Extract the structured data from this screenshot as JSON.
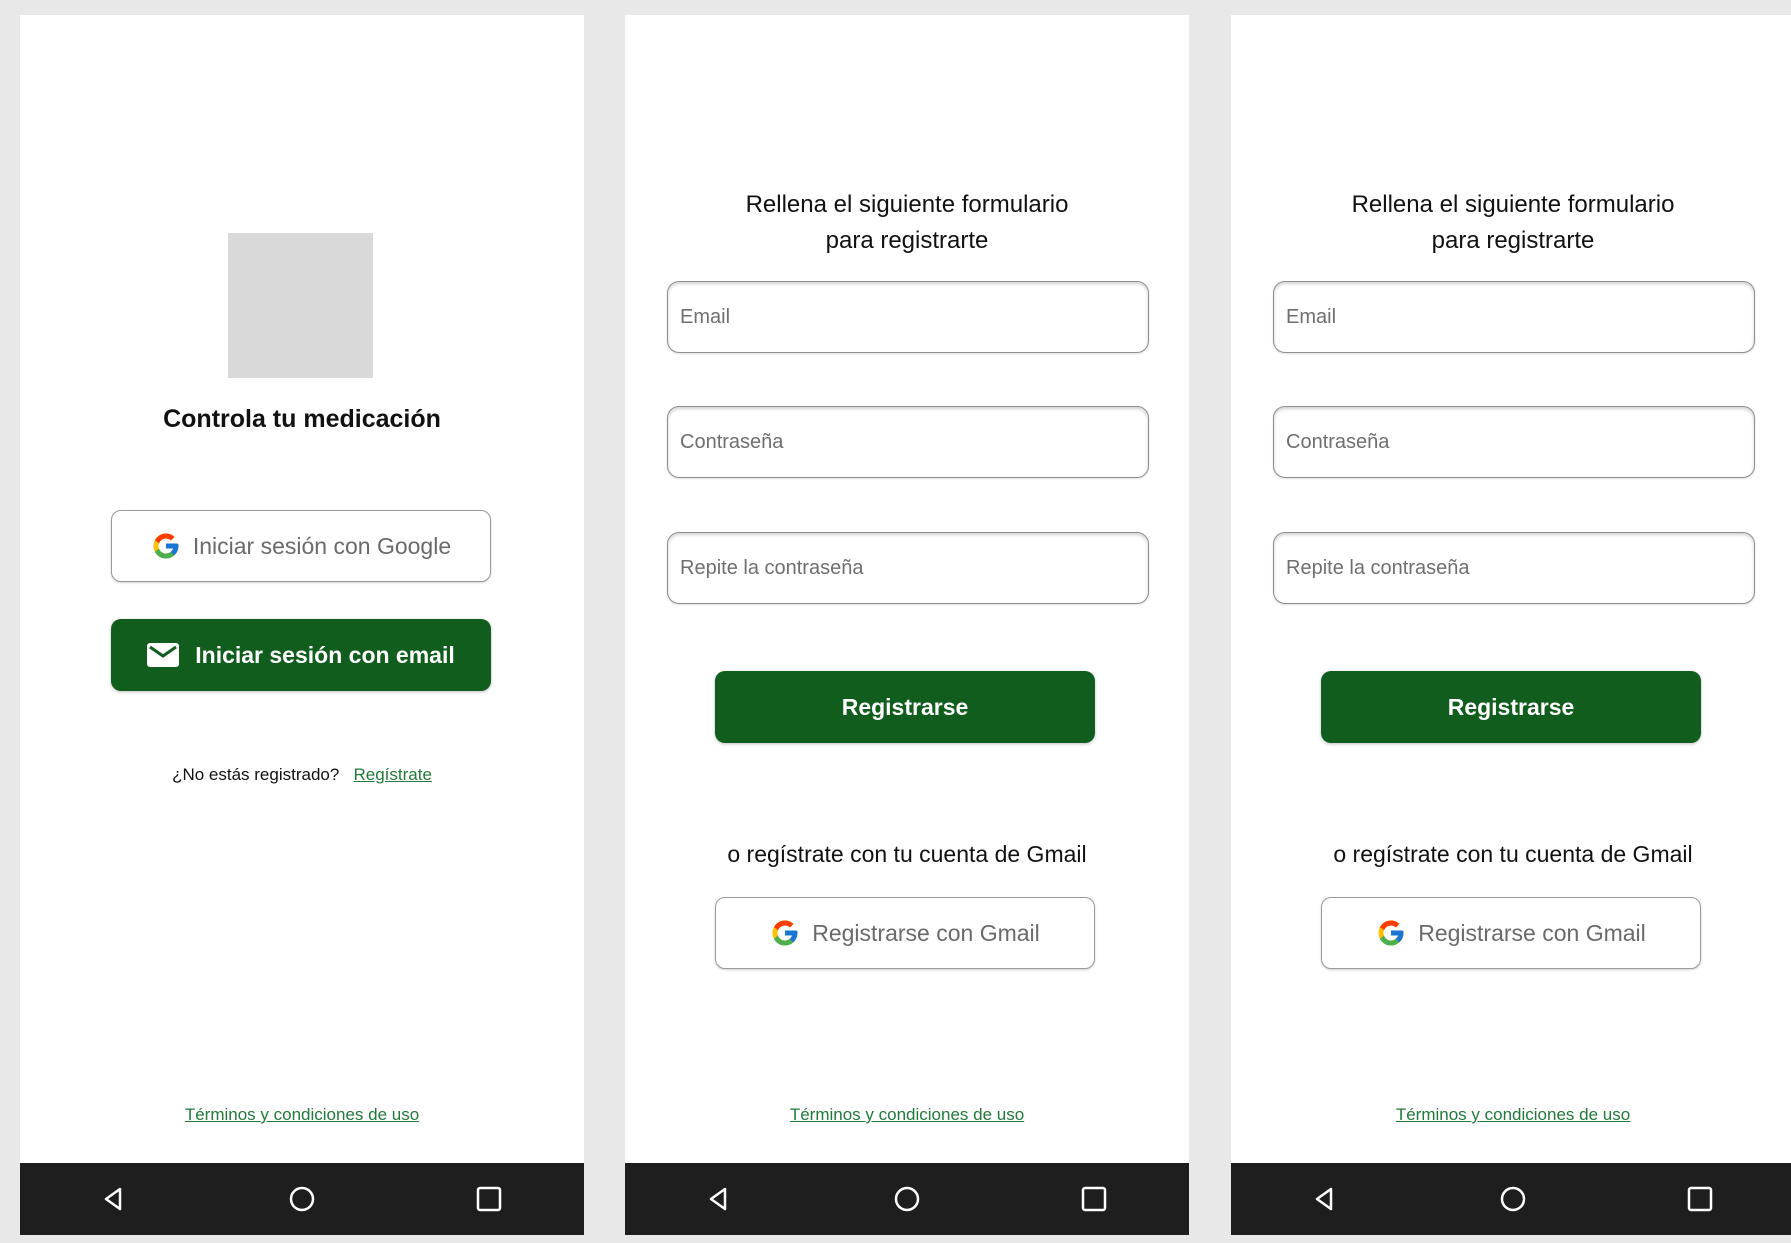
{
  "login": {
    "title": "Controla tu medicación",
    "google_button": "Iniciar sesión con Google",
    "email_button": "Iniciar sesión con email",
    "not_registered": "¿No estás registrado?",
    "register_link": "Regístrate",
    "terms": "Términos y condiciones de uso"
  },
  "register": {
    "title_line1": "Rellena el siguiente formulario",
    "title_line2": "para registrarte",
    "email_placeholder": "Email",
    "password_placeholder": "Contraseña",
    "repeat_password_placeholder": "Repite la contraseña",
    "submit_button": "Registrarse",
    "or_text": "o regístrate con tu cuenta de Gmail",
    "gmail_button": "Registrarse con Gmail",
    "terms": "Términos y condiciones de uso"
  },
  "navigation": {
    "back_icon": "back-triangle-icon",
    "home_icon": "home-circle-icon",
    "recents_icon": "recents-square-icon"
  },
  "colors": {
    "primary_green": "#105d1e",
    "link_green": "#217a3b",
    "navbar": "#1e1e1e",
    "background": "#e8e8e8"
  }
}
